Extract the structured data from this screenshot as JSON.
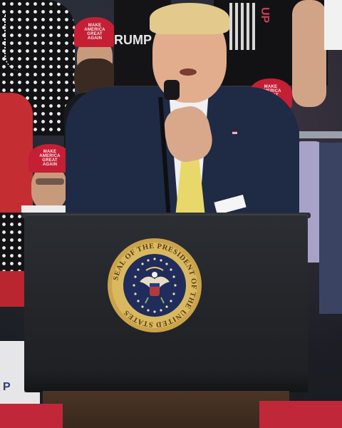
{
  "scene": {
    "description_alt": "Speaker at podium with presidential seal in front of a rally crowd"
  },
  "seal": {
    "ring_text": "SEAL OF THE PRESIDENT OF THE UNITED STATES",
    "colors": {
      "gold": "#c9a24a",
      "blue": "#1f2c5c",
      "ring": "#d9b860"
    }
  },
  "crowd": {
    "hat_text": "MAKE\nAMERICA\nGREAT\nAGAIN",
    "shirt_text_left": "RUMP",
    "shirt_text_right": "UP",
    "shirt_text_bottom": "P"
  },
  "colors": {
    "suit": "#1f2a44",
    "tie": "#e8d86a",
    "hat": "#c41f35",
    "podium": "#25282c"
  }
}
